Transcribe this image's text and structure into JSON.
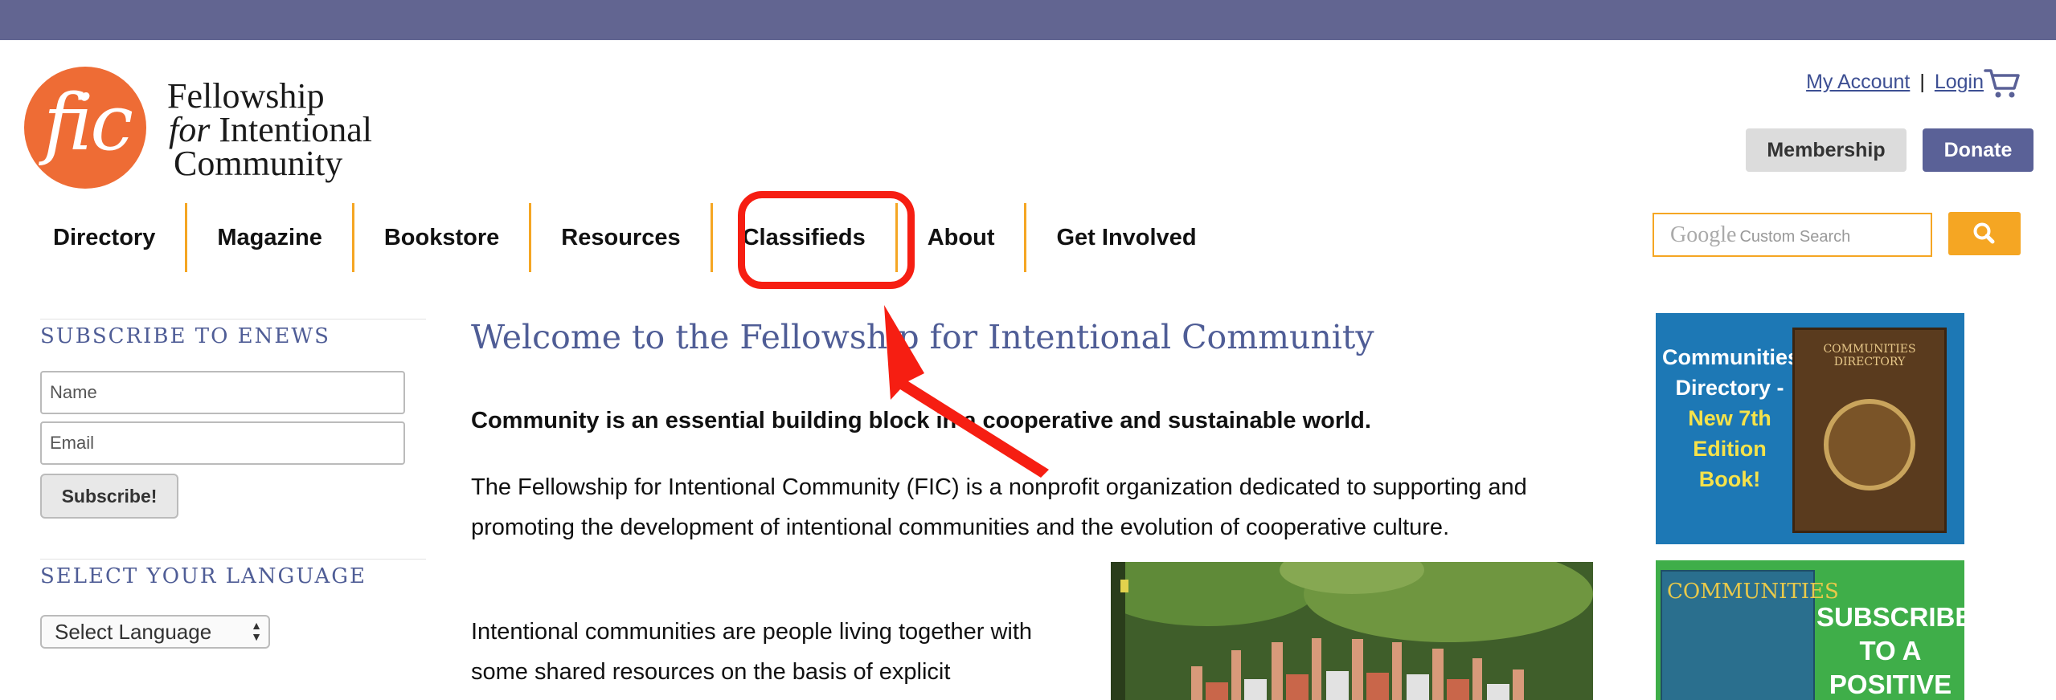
{
  "colors": {
    "topbar": "#626591",
    "brand_orange": "#ee6c35",
    "nav_divider": "#f5a623",
    "heading_blue": "#4f5d96",
    "donate": "#5a6197",
    "annotation_red": "#f61e12"
  },
  "logo": {
    "mark": "fic",
    "line1": "Fellowship",
    "line2_italic": "for",
    "line2": " Intentional",
    "line3": "Community"
  },
  "header": {
    "my_account": "My Account",
    "separator": "|",
    "login": "Login",
    "cart_icon": "cart-icon",
    "membership": "Membership",
    "donate": "Donate"
  },
  "nav": {
    "items": [
      {
        "label": "Directory"
      },
      {
        "label": "Magazine"
      },
      {
        "label": "Bookstore"
      },
      {
        "label": "Resources"
      },
      {
        "label": "Classifieds"
      },
      {
        "label": "About"
      },
      {
        "label": "Get Involved"
      }
    ]
  },
  "search": {
    "google": "Google",
    "placeholder": "Custom Search",
    "icon": "search-icon"
  },
  "sidebar": {
    "enews_heading": "SUBSCRIBE TO ENEWS",
    "name_placeholder": "Name",
    "email_placeholder": "Email",
    "subscribe_button": "Subscribe!",
    "language_heading": "SELECT YOUR LANGUAGE",
    "language_select": "Select Language"
  },
  "main": {
    "title": "Welcome to the Fellowship for Intentional Community",
    "lead": "Community is an essential building block in a cooperative and sustainable world.",
    "paragraph1": "The Fellowship for Intentional Community (FIC) is a nonprofit organization dedicated to supporting and promoting the development of intentional communities and the evolution of cooperative culture.",
    "paragraph2": "Intentional communities are people living together with some shared resources on the basis of explicit"
  },
  "ads": {
    "directory": {
      "line1": "Communities",
      "line2": "Directory -",
      "line3": "New 7th",
      "line4": "Edition",
      "line5": "Book!",
      "book_title": "COMMUNITIES DIRECTORY"
    },
    "magazine": {
      "mag_title": "COMMUNITIES",
      "line1": "SUBSCRIBE",
      "line2": "TO A",
      "line3": "POSITIVE"
    }
  }
}
